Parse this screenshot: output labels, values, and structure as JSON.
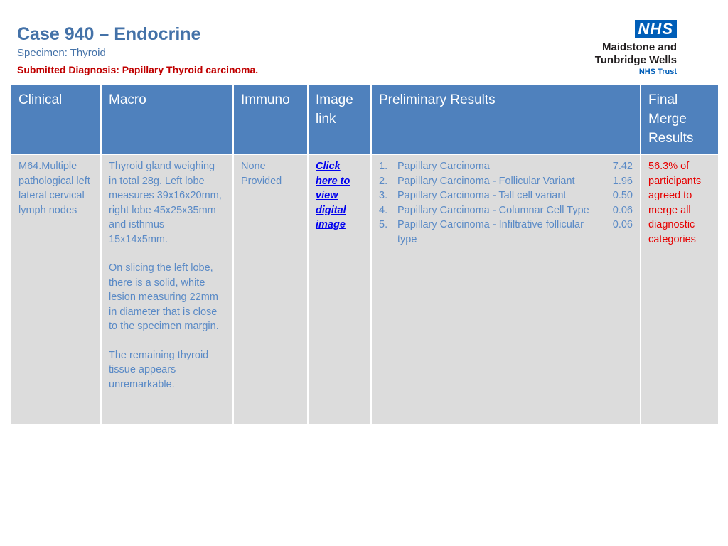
{
  "header": {
    "case_title": "Case 940 – Endocrine",
    "specimen": "Specimen: Thyroid",
    "submitted_diagnosis": "Submitted Diagnosis: Papillary Thyroid carcinoma."
  },
  "logo": {
    "nhs": "NHS",
    "org_line1": "Maidstone and",
    "org_line2": "Tunbridge Wells",
    "trust": "NHS Trust",
    "brand_color": "#005eb8"
  },
  "table": {
    "headers": {
      "clinical": "Clinical",
      "macro": "Macro",
      "immuno": "Immuno",
      "image_link": "Image link",
      "preliminary": "Preliminary Results",
      "final": "Final Merge Results"
    },
    "clinical": "M64.Multiple pathological left lateral cervical lymph nodes",
    "macro": [
      "Thyroid gland weighing in total 28g. Left lobe measures 39x16x20mm, right lobe 45x25x35mm and isthmus 15x14x5mm.",
      "On slicing the left lobe, there is a solid, white lesion measuring 22mm in diameter that is close to the specimen margin.",
      "The remaining thyroid tissue appears unremarkable."
    ],
    "immuno": "None Provided",
    "image_link": "Click here to view digital image",
    "preliminary": [
      {
        "num": "1.",
        "name": "Papillary Carcinoma",
        "value": "7.42"
      },
      {
        "num": "2.",
        "name": "Papillary Carcinoma - Follicular Variant",
        "value": "1.96"
      },
      {
        "num": "3.",
        "name": "Papillary Carcinoma - Tall cell variant",
        "value": "0.50"
      },
      {
        "num": "4.",
        "name": "Papillary Carcinoma - Columnar Cell Type",
        "value": "0.06"
      },
      {
        "num": "5.",
        "name": "Papillary Carcinoma - Infiltrative follicular type",
        "value": "0.06"
      }
    ],
    "final": "56.3% of participants agreed to merge all diagnostic categories"
  },
  "colors": {
    "header_bg": "#4f81bd",
    "cell_bg": "#dcdcdc",
    "body_text": "#5a8ac6",
    "diagnosis_red": "#c00000",
    "final_red": "#e60000",
    "link_blue": "#0000ee"
  }
}
